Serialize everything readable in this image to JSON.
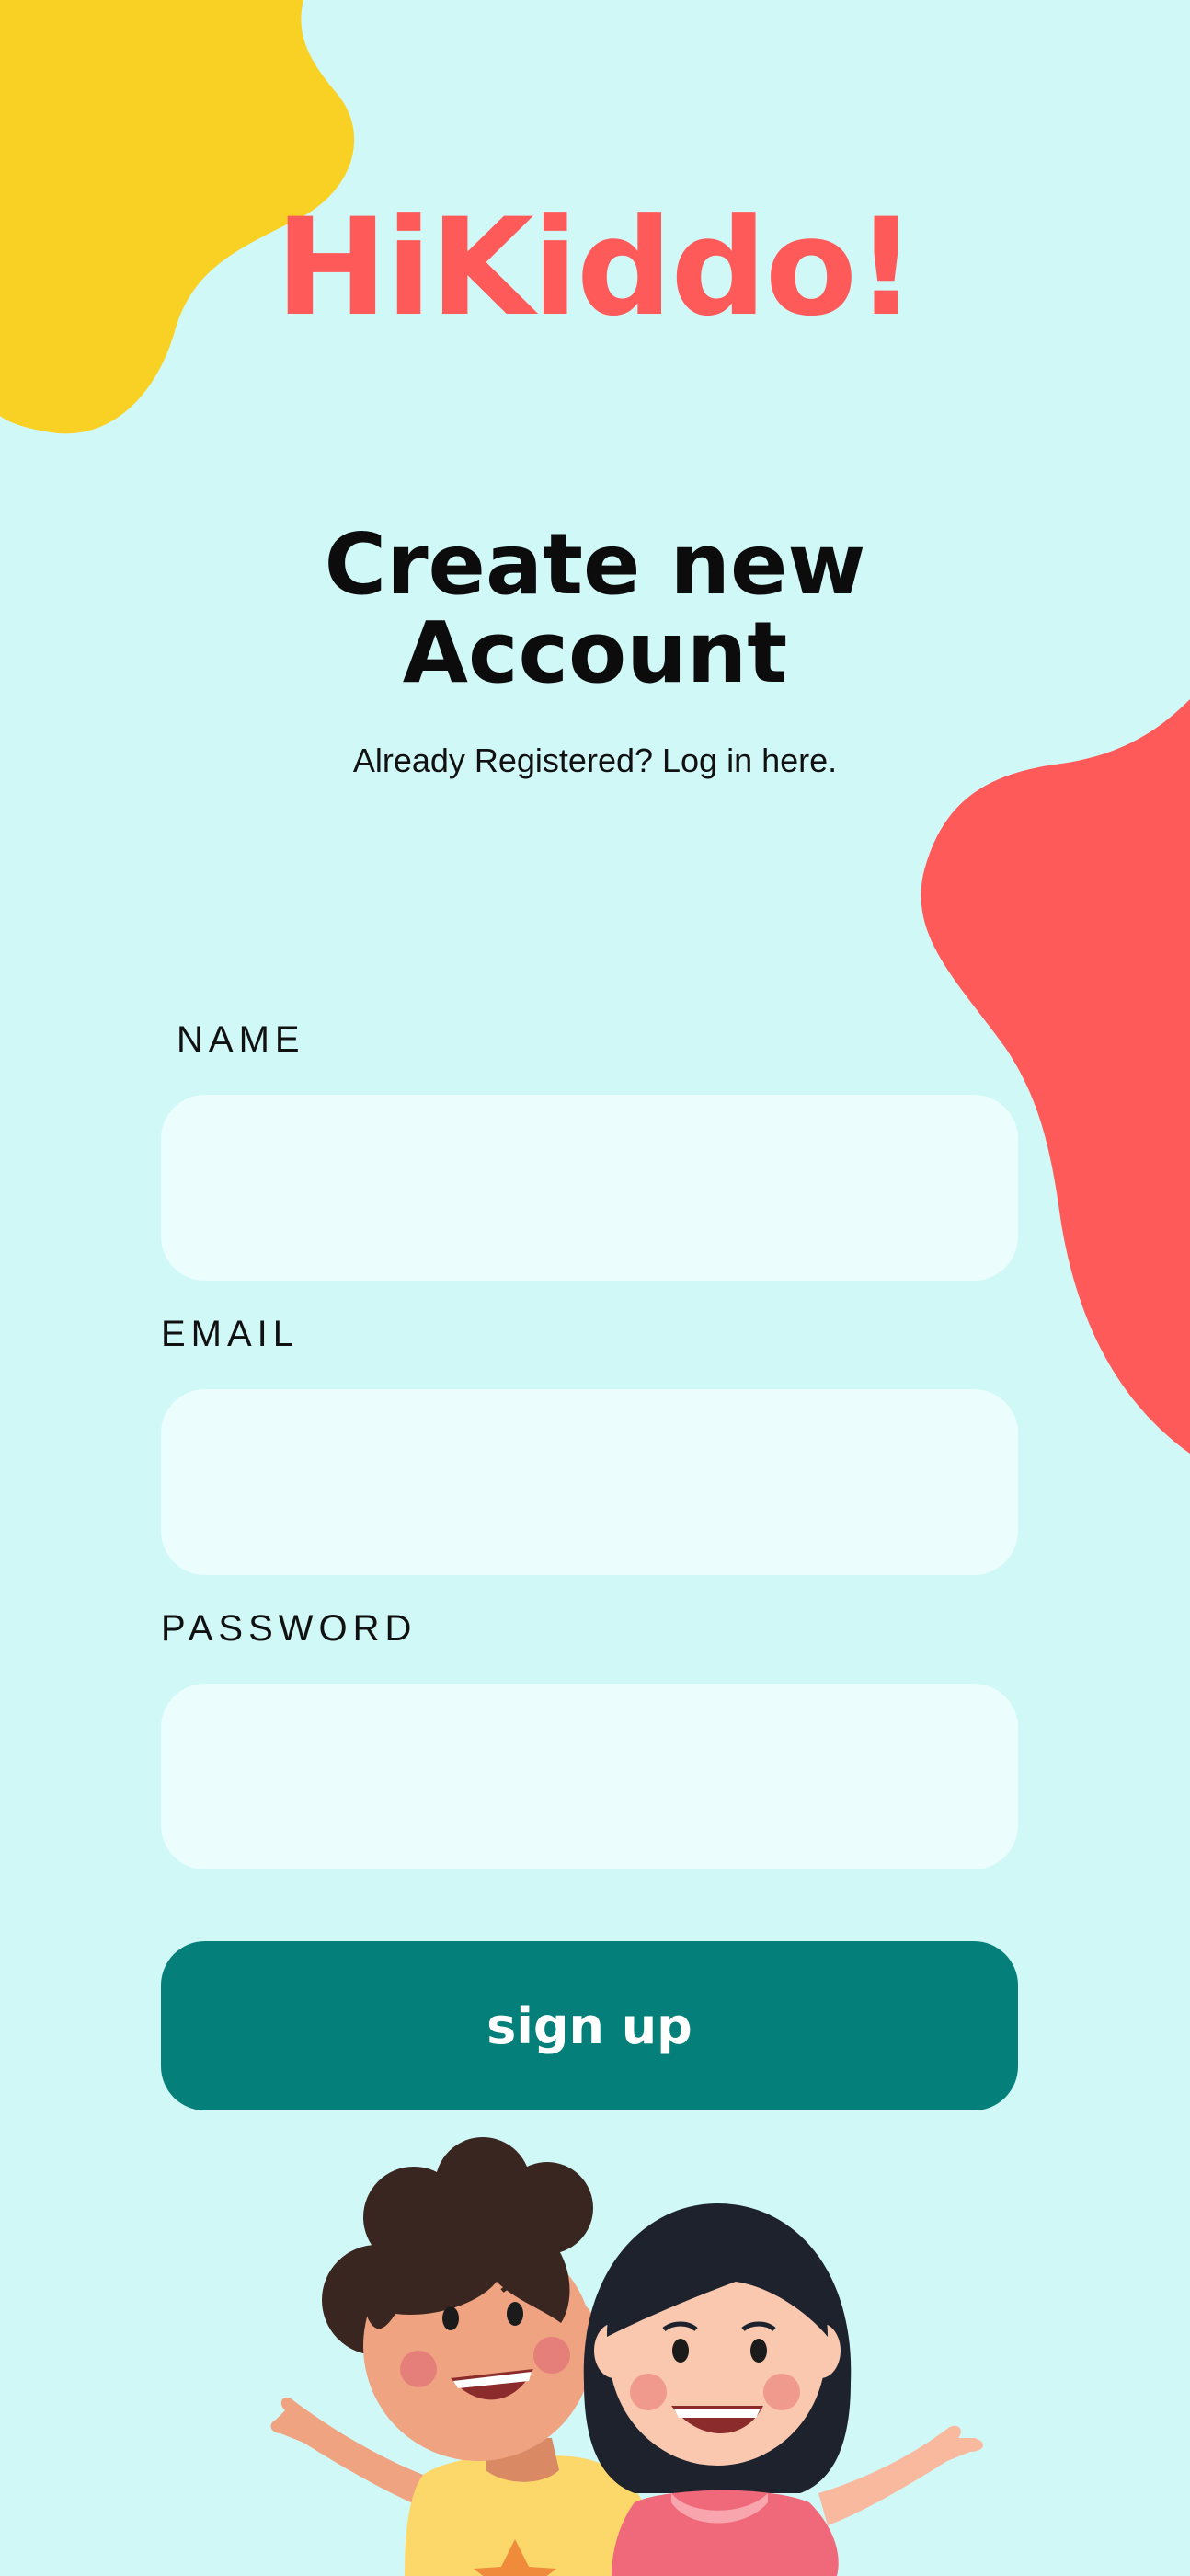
{
  "app": {
    "logo_text": "HiKiddo!",
    "title_line1": "Create new",
    "title_line2": "Account",
    "login_prompt": "Already Registered? Log in here."
  },
  "form": {
    "name_label": "NAME",
    "name_value": "",
    "email_label": "EMAIL",
    "email_value": "",
    "password_label": "PASSWORD",
    "password_value": "",
    "submit_label": "sign up"
  },
  "colors": {
    "background": "#d0f8f7",
    "logo": "#ff5a5a",
    "accent_yellow": "#f9d024",
    "accent_red": "#ff5a5a",
    "field_bg": "#ebfdfd",
    "button": "#057f79"
  },
  "icons": {
    "illustration": "two-kids-waving-illustration"
  }
}
